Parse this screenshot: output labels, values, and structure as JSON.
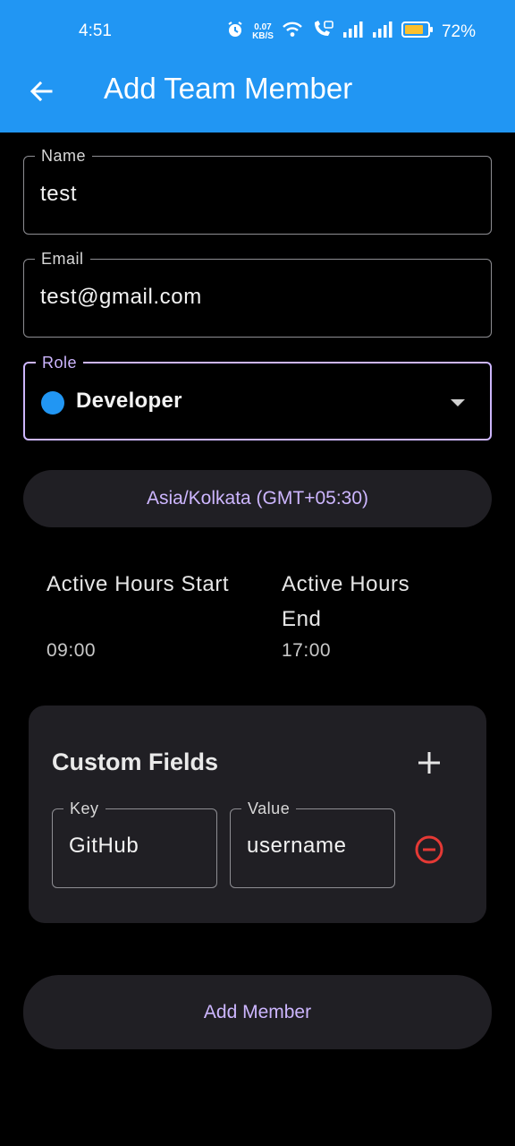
{
  "status": {
    "time": "4:51",
    "net_speed_value": "0.07",
    "net_speed_unit": "KB/S",
    "battery": "72%"
  },
  "header": {
    "title": "Add Team Member"
  },
  "form": {
    "name": {
      "label": "Name",
      "value": "test"
    },
    "email": {
      "label": "Email",
      "value": "test@gmail.com"
    },
    "role": {
      "label": "Role",
      "value": "Developer",
      "color": "#2196f3"
    },
    "timezone_label": "Asia/Kolkata (GMT+05:30)",
    "active_start": {
      "label": "Active Hours Start",
      "value": "09:00"
    },
    "active_end": {
      "label": "Active Hours End",
      "value": "17:00"
    }
  },
  "custom_fields": {
    "title": "Custom Fields",
    "items": [
      {
        "key_label": "Key",
        "key_value": "GitHub",
        "value_label": "Value",
        "value_value": "username"
      }
    ]
  },
  "submit_label": "Add Member",
  "colors": {
    "app_bar": "#2196f3",
    "accent": "#cdb6ff",
    "danger": "#e53935",
    "card": "#201f24",
    "background": "#000000"
  }
}
